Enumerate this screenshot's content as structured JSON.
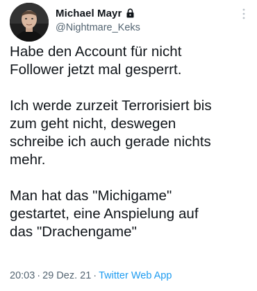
{
  "author": {
    "display_name": "Michael Mayr",
    "handle": "@Nightmare_Keks",
    "avatar_icon": "profile-photo",
    "protected_icon": "lock-icon"
  },
  "tweet": {
    "paragraphs": [
      "Habe den Account für nicht\nFollower jetzt mal gesperrt.",
      "Ich werde zurzeit Terrorisiert bis\nzum geht nicht, deswegen\nschreibe ich auch gerade nichts\nmehr.",
      "Man hat das \"Michigame\"\ngestartet, eine Anspielung auf\ndas \"Drachengame\""
    ],
    "time": "20:03",
    "date": "29 Dez. 21",
    "source": "Twitter Web App",
    "separator": "·"
  },
  "colors": {
    "text": "#0f1419",
    "muted": "#536471",
    "link": "#1d9bf0"
  }
}
